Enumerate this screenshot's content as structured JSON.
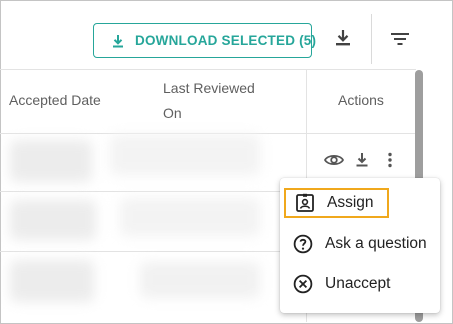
{
  "toolbar": {
    "download_selected_label": "DOWNLOAD SELECTED (5)",
    "download_icon": "download-icon",
    "filter_icon": "filter-icon",
    "accent_color": "#26a69a"
  },
  "table": {
    "columns": [
      {
        "label": "Accepted Date"
      },
      {
        "label": "Last Reviewed On"
      },
      {
        "label": "Actions"
      }
    ]
  },
  "row_actions": {
    "icons": [
      "eye-icon",
      "download-icon",
      "more-vert-icon"
    ]
  },
  "menu": {
    "items": [
      {
        "label": "Assign",
        "icon": "assign-badge-icon"
      },
      {
        "label": "Ask a question",
        "icon": "help-circle-icon"
      },
      {
        "label": "Unaccept",
        "icon": "close-circle-icon"
      }
    ],
    "highlight_color": "#f0a81c"
  }
}
